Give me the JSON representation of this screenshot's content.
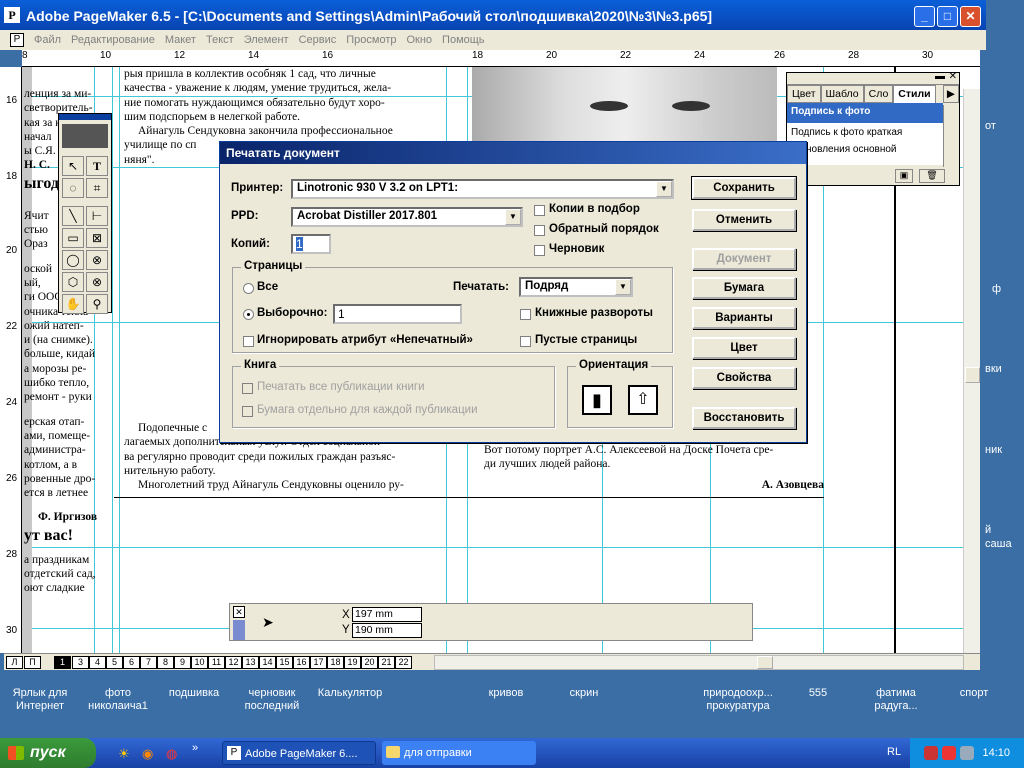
{
  "window": {
    "title": "Adobe PageMaker 6.5 - [C:\\Documents and Settings\\Admin\\Рабочий стол\\подшивка\\2020\\№3\\№3.p65]",
    "app_icon": "P",
    "min": "_",
    "max": "□",
    "close": "✕"
  },
  "menu": [
    "Файл",
    "Редактирование",
    "Макет",
    "Текст",
    "Элемент",
    "Сервис",
    "Просмотр",
    "Окно",
    "Помощь"
  ],
  "ruler": {
    "h": [
      "8",
      "10",
      "12",
      "14",
      "16",
      "18",
      "20",
      "22",
      "24",
      "26",
      "28",
      "30"
    ],
    "v": [
      "16",
      "18",
      "20",
      "22",
      "24",
      "26",
      "28",
      "30"
    ]
  },
  "doc": {
    "left_col": [
      "ленция за ми-",
      "светворитель-",
      "кая за ка-",
      "начал",
      "ы С.Я.",
      "Н. С.",
      "ыгод",
      "",
      "Ячит",
      "стью",
      "Ораз",
      "",
      "оской",
      "ый,",
      "ги ООО \"Юг",
      "очника тепла",
      "ожий натеп-",
      "и (на снимке).",
      "больше, кидай",
      "а морозы ре-",
      "шибко тепло,",
      "ремонт - руки",
      "",
      "ерская отап-",
      "ами, помеще-",
      "администра-",
      "котлом, а в",
      "ровенные дро-",
      "ется в летнее",
      "",
      "Ф. Иргизов",
      "ут вас!",
      "",
      "а праздникам",
      "отдетский сад,",
      "оют сладкие"
    ],
    "main_col": [
      "рыя пришла в коллектив особняк 1 сад, что личные",
      "качества - уважение к людям, умение трудиться, жела-",
      "ние помогать нуждающимся обязательно будут хоро-",
      "шим подспорьем в нелегкой работе.",
      "Айнагуль Сендуковна закончила профессиональное",
      "училище по сп",
      "няня\"."
    ],
    "right_text": [
      "Вот потому портрет А.С. Алексеевой на Доске Почета сре-",
      "ди лучших людей района."
    ],
    "signature": "А. Азовцева",
    "bottom_text": [
      "лагаемых дополнительных услуг. Отдел социальной",
      "ва регулярно проводит среди пожилых граждан разъяс-",
      "нительную работу.",
      "Многолетний труд Айнагуль Сендуковны оценило ру-"
    ],
    "under_dialog_left": [
      "Подопечные с"
    ]
  },
  "palette": {
    "tabs": [
      "Цвет",
      "Шабло",
      "Сло",
      "Стили"
    ],
    "items": [
      "Подпись к фото",
      "Подпись к фото  краткая",
      "становления  основной"
    ]
  },
  "dialog": {
    "title": "Печатать документ",
    "printer_label": "Принтер:",
    "printer_value": "Linotronic 930 V 3.2 on LPT1:",
    "ppd_label": "PPD:",
    "ppd_value": "Acrobat Distiller 2017.801",
    "copies_label": "Копий:",
    "copies_value": "1",
    "collate": "Копии в подбор",
    "reverse": "Обратный порядок",
    "draft": "Черновик",
    "pages_group": "Страницы",
    "all": "Все",
    "print_label": "Печатать:",
    "print_value": "Подряд",
    "selected": "Выборочно:",
    "range_value": "1",
    "spreads": "Книжные развороты",
    "ignore": "Игнорировать атрибут «Непечатный»",
    "blank": "Пустые страницы",
    "book_group": "Книга",
    "book_all": "Печатать все публикации книги",
    "book_paper": "Бумага отдельно для каждой публикации",
    "orient_group": "Ориентация",
    "buttons": [
      "Сохранить",
      "Отменить",
      "Документ",
      "Бумага",
      "Варианты",
      "Цвет",
      "Свойства",
      "Восстановить"
    ]
  },
  "control": {
    "x_label": "X",
    "x_value": "197 mm",
    "y_label": "Y",
    "y_value": "190 mm"
  },
  "pages": [
    "Л",
    "П",
    "1",
    "3",
    "4",
    "5",
    "6",
    "7",
    "8",
    "9",
    "10",
    "11",
    "12",
    "13",
    "14",
    "15",
    "16",
    "17",
    "18",
    "19",
    "20",
    "21",
    "22"
  ],
  "desktop": [
    {
      "label": "Ярлык для Интернет"
    },
    {
      "label": "фото николаича1"
    },
    {
      "label": "подшивка"
    },
    {
      "label": "черновик последний"
    },
    {
      "label": "Калькулятор"
    },
    {
      "label": "кривов"
    },
    {
      "label": "скрин"
    },
    {
      "label": "природоохр... прокуратура"
    },
    {
      "label": "555"
    },
    {
      "label": "фатима радуга..."
    },
    {
      "label": "спорт"
    }
  ],
  "right_side": [
    "от",
    "ф",
    "вки",
    "ник",
    "й",
    "саша"
  ],
  "taskbar": {
    "start": "пуск",
    "tasks": [
      "Adobe PageMaker 6....",
      "для отправки"
    ],
    "lang": "RL",
    "clock": "14:10"
  }
}
